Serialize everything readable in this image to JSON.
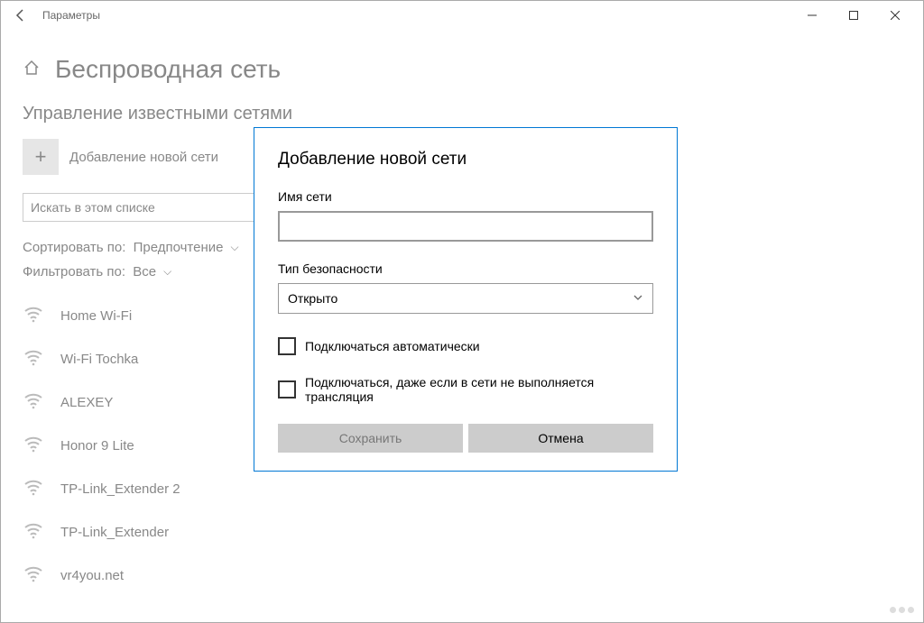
{
  "titlebar": {
    "app_name": "Параметры"
  },
  "page": {
    "title": "Беспроводная сеть"
  },
  "section": {
    "heading": "Управление известными сетями",
    "add_label": "Добавление новой сети",
    "search_placeholder": "Искать в этом списке",
    "sort_label": "Сортировать по:",
    "sort_value": "Предпочтение",
    "filter_label": "Фильтровать по:",
    "filter_value": "Все"
  },
  "networks": [
    {
      "name": "Home Wi-Fi"
    },
    {
      "name": "Wi-Fi Tochka"
    },
    {
      "name": "ALEXEY"
    },
    {
      "name": "Honor 9 Lite"
    },
    {
      "name": "TP-Link_Extender 2"
    },
    {
      "name": "TP-Link_Extender"
    },
    {
      "name": "vr4you.net"
    }
  ],
  "dialog": {
    "title": "Добавление новой сети",
    "name_label": "Имя сети",
    "name_value": "",
    "security_label": "Тип безопасности",
    "security_value": "Открыто",
    "auto_connect": "Подключаться автоматически",
    "connect_hidden": "Подключаться, даже если в сети не выполняется трансляция",
    "save": "Сохранить",
    "cancel": "Отмена"
  }
}
